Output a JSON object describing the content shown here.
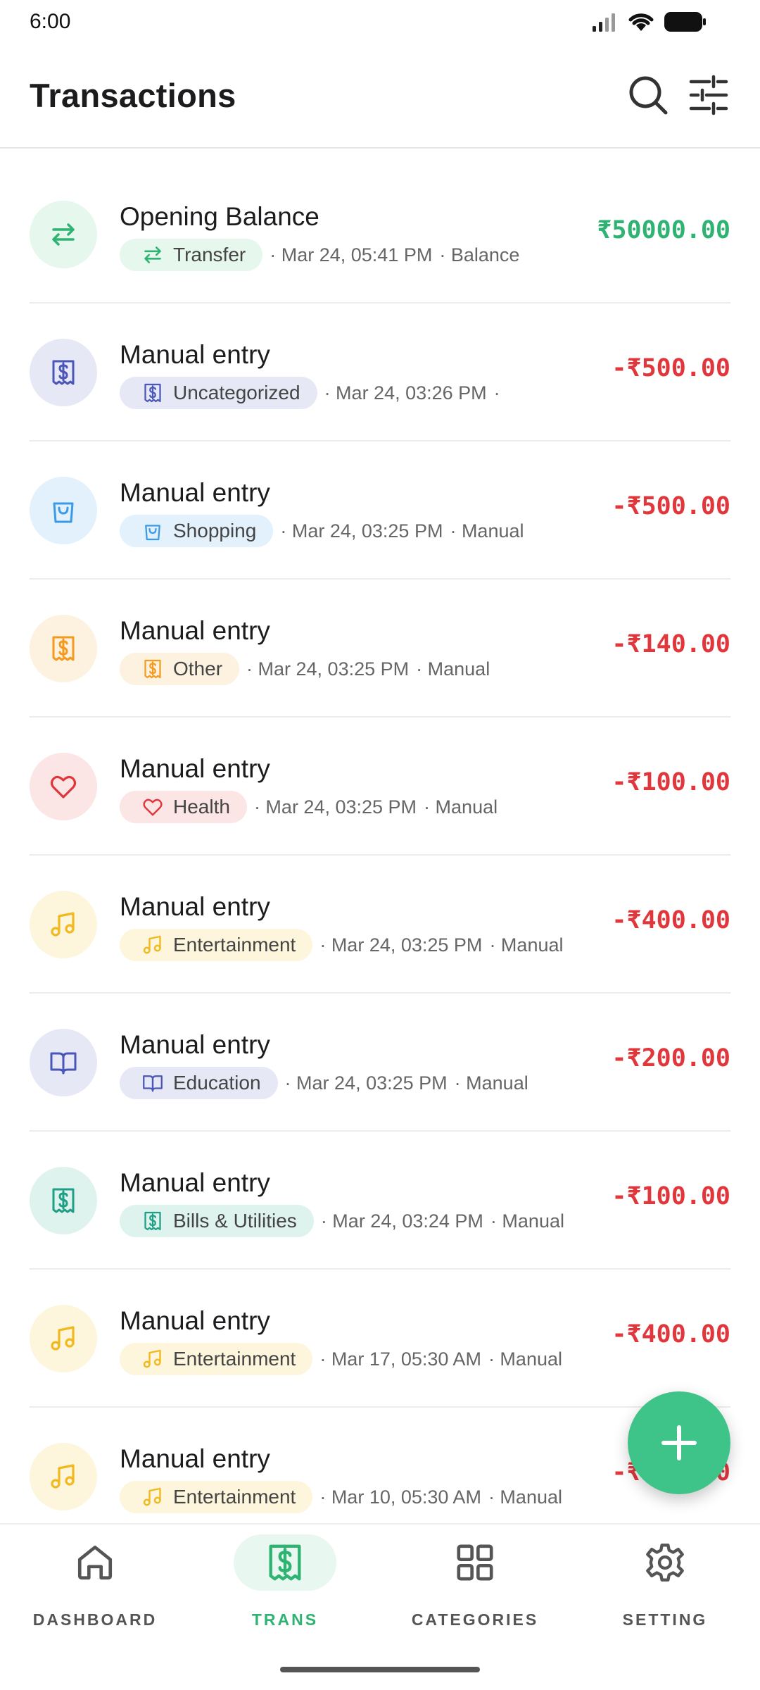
{
  "status_bar": {
    "time": "6:00"
  },
  "header": {
    "title": "Transactions"
  },
  "icons": {
    "search": "search-icon",
    "filter": "sliders-icon",
    "fab": "plus-icon"
  },
  "colors": {
    "accent": "#3ec489",
    "positive": "#2fb372",
    "negative": "#e0373c"
  },
  "transactions": [
    {
      "title": "Opening Balance",
      "category": "Transfer",
      "icon": "arrows-exchange-icon",
      "datetime": "Mar 24, 05:41 PM",
      "source": "Balance",
      "amount": "₹50000.00",
      "type": "positive",
      "bg": "#e6f7ee",
      "chip": "#e6f7ee",
      "fg": "#2fb372"
    },
    {
      "title": "Manual entry",
      "category": "Uncategorized",
      "icon": "receipt-icon",
      "datetime": "Mar 24, 03:26 PM",
      "source": "",
      "amount": "-₹500.00",
      "type": "negative",
      "bg": "#e6e8f6",
      "chip": "#e6e8f6",
      "fg": "#4a56b8"
    },
    {
      "title": "Manual entry",
      "category": "Shopping",
      "icon": "shopping-bag-icon",
      "datetime": "Mar 24, 03:25 PM",
      "source": "Manual",
      "amount": "-₹500.00",
      "type": "negative",
      "bg": "#e3f1fc",
      "chip": "#e3f1fc",
      "fg": "#3b9ae8"
    },
    {
      "title": "Manual entry",
      "category": "Other",
      "icon": "receipt-icon",
      "datetime": "Mar 24, 03:25 PM",
      "source": "Manual",
      "amount": "-₹140.00",
      "type": "negative",
      "bg": "#fdf1e0",
      "chip": "#fdf1e0",
      "fg": "#f29b1f"
    },
    {
      "title": "Manual entry",
      "category": "Health",
      "icon": "heart-icon",
      "datetime": "Mar 24, 03:25 PM",
      "source": "Manual",
      "amount": "-₹100.00",
      "type": "negative",
      "bg": "#fbe5e5",
      "chip": "#fbe5e5",
      "fg": "#e0373c"
    },
    {
      "title": "Manual entry",
      "category": "Entertainment",
      "icon": "music-note-icon",
      "datetime": "Mar 24, 03:25 PM",
      "source": "Manual",
      "amount": "-₹400.00",
      "type": "negative",
      "bg": "#fdf6dc",
      "chip": "#fdf6dc",
      "fg": "#f2b91f"
    },
    {
      "title": "Manual entry",
      "category": "Education",
      "icon": "book-open-icon",
      "datetime": "Mar 24, 03:25 PM",
      "source": "Manual",
      "amount": "-₹200.00",
      "type": "negative",
      "bg": "#e6e8f6",
      "chip": "#e6e8f6",
      "fg": "#4a56b8"
    },
    {
      "title": "Manual entry",
      "category": "Bills & Utilities",
      "icon": "receipt-icon",
      "datetime": "Mar 24, 03:24 PM",
      "source": "Manual",
      "amount": "-₹100.00",
      "type": "negative",
      "bg": "#dff3ee",
      "chip": "#dff3ee",
      "fg": "#1f9f86"
    },
    {
      "title": "Manual entry",
      "category": "Entertainment",
      "icon": "music-note-icon",
      "datetime": "Mar 17, 05:30 AM",
      "source": "Manual",
      "amount": "-₹400.00",
      "type": "negative",
      "bg": "#fdf6dc",
      "chip": "#fdf6dc",
      "fg": "#f2b91f"
    },
    {
      "title": "Manual entry",
      "category": "Entertainment",
      "icon": "music-note-icon",
      "datetime": "Mar 10, 05:30 AM",
      "source": "Manual",
      "amount": "-₹400.00",
      "type": "negative",
      "bg": "#fdf6dc",
      "chip": "#fdf6dc",
      "fg": "#f2b91f"
    }
  ],
  "nav": [
    {
      "label": "DASHBOARD",
      "icon": "home-icon",
      "active": false
    },
    {
      "label": "TRANS",
      "icon": "receipt-icon",
      "active": true
    },
    {
      "label": "CATEGORIES",
      "icon": "grid-icon",
      "active": false
    },
    {
      "label": "SETTING",
      "icon": "gear-icon",
      "active": false
    }
  ]
}
